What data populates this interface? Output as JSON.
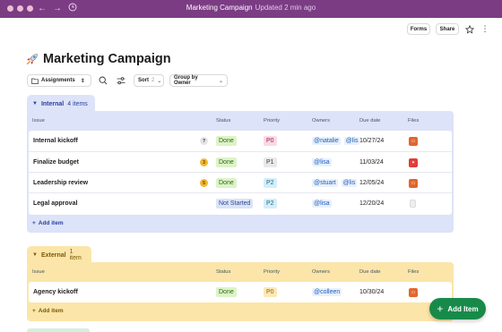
{
  "window": {
    "title": "Marketing Campaign",
    "subtitle": "Updated 2 min ago"
  },
  "header": {
    "forms_label": "Forms",
    "share_label": "Share"
  },
  "page": {
    "title": "Marketing Campaign"
  },
  "toolbar": {
    "view_label": "Assignments",
    "sort_label": "Sort",
    "sort_count": "2",
    "group_label": "Group by Owner"
  },
  "columns": {
    "issue": "Issue",
    "status": "Status",
    "priority": "Priority",
    "owners": "Owners",
    "due": "Due date",
    "files": "Files"
  },
  "sections": {
    "internal": {
      "name": "Internal",
      "count": "4 items",
      "add_label": "Add item",
      "rows": [
        {
          "issue": "Internal kickoff",
          "badge": "?",
          "status": "Done",
          "priority": "P0",
          "owners": [
            "@natalie",
            "@lis"
          ],
          "due": "10/27/24",
          "file": "orange"
        },
        {
          "issue": "Finalize budget",
          "badge": "3",
          "status": "Done",
          "priority": "P1",
          "owners": [
            "@lisa"
          ],
          "due": "11/03/24",
          "file": "red"
        },
        {
          "issue": "Leadership review",
          "badge": "5",
          "status": "Done",
          "priority": "P2",
          "owners": [
            "@stuart",
            "@lis"
          ],
          "due": "12/05/24",
          "file": "orange"
        },
        {
          "issue": "Legal approval",
          "badge": "",
          "status": "Not Started",
          "priority": "P2",
          "owners": [
            "@lisa"
          ],
          "due": "12/20/24",
          "file": "blank"
        }
      ]
    },
    "external": {
      "name": "External",
      "count": "1 item",
      "add_label": "Add item",
      "rows": [
        {
          "issue": "Agency kickoff",
          "status": "Done",
          "priority": "P0",
          "owners": [
            "@colleen"
          ],
          "due": "10/30/24",
          "file": "orange"
        }
      ]
    }
  },
  "fab": {
    "label": "Add Item"
  },
  "colors": {
    "titlebar": "#7b3c84",
    "internal_bg": "#dde3f8",
    "external_bg": "#fbe5a9",
    "fab": "#178a4a"
  }
}
